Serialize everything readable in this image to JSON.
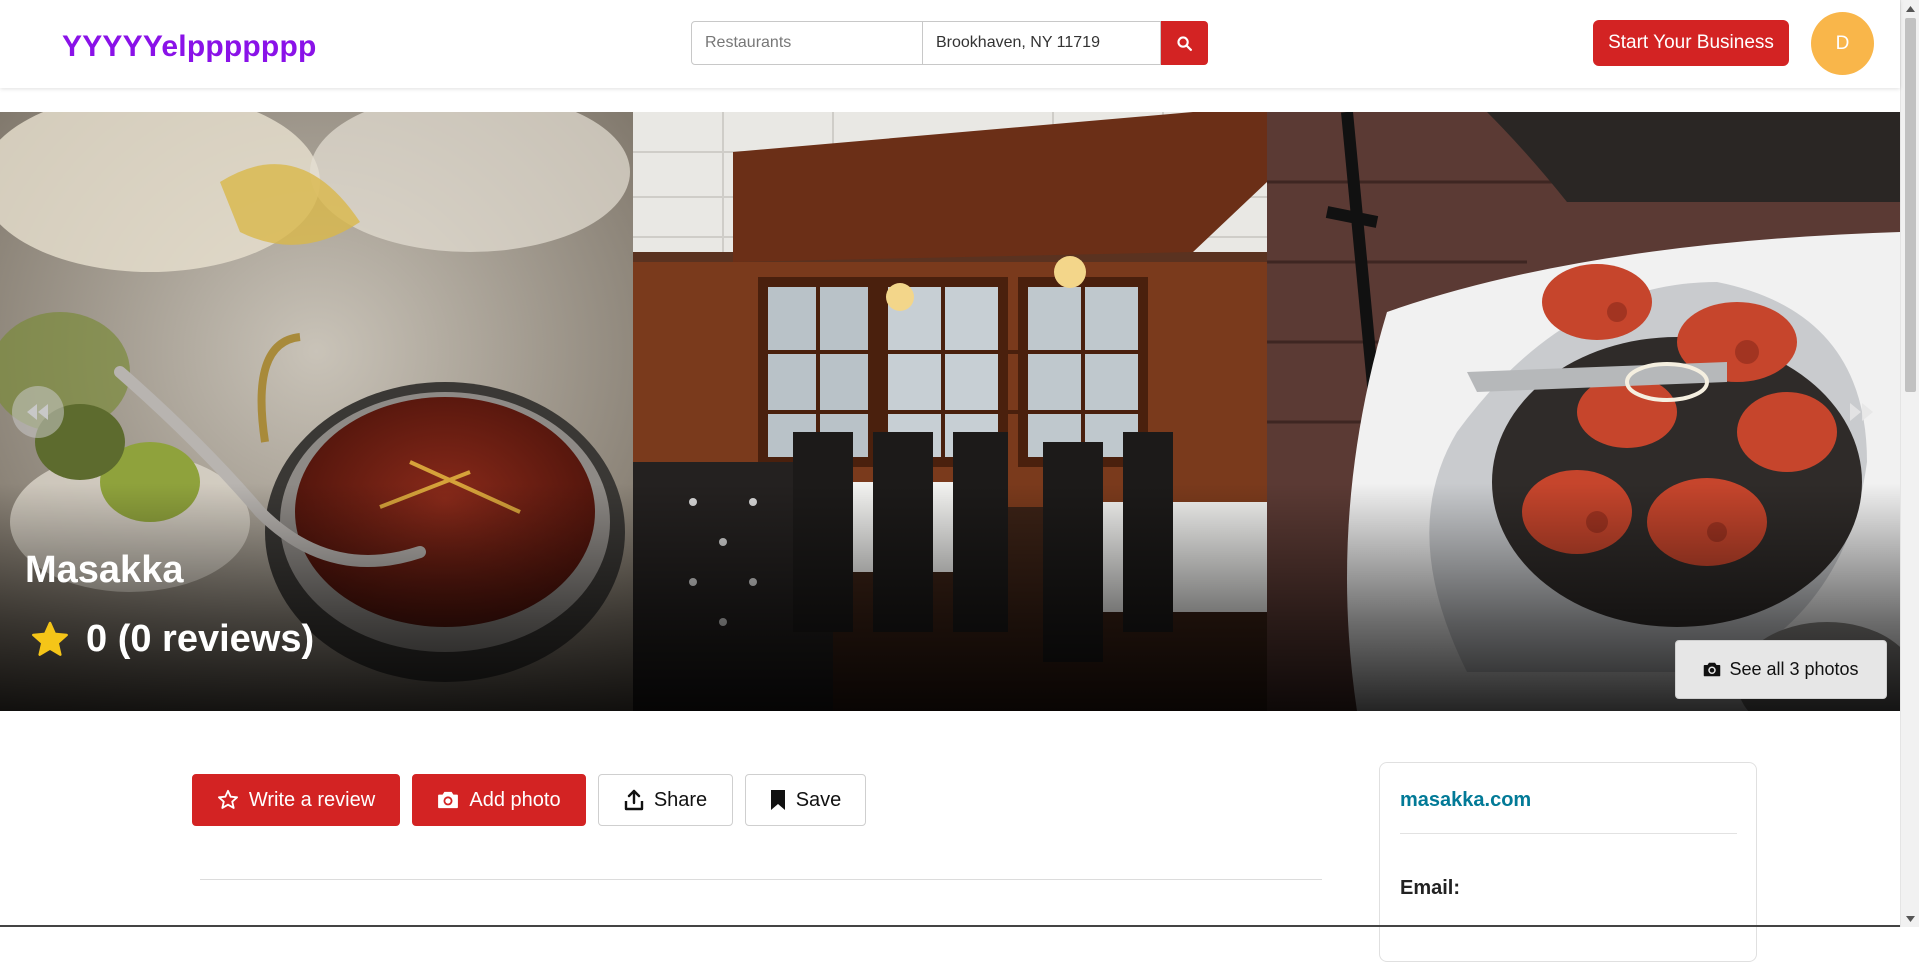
{
  "header": {
    "logo": "YYYYYelppppppp",
    "search_find_placeholder": "Restaurants",
    "search_near_value": "Brookhaven, NY 11719",
    "search_button_icon": "search-icon",
    "start_business_label": "Start Your Business",
    "avatar_initial": "D"
  },
  "hero": {
    "business_name": "Masakka",
    "rating_text": "0 (0 reviews)",
    "rating_icon": "star-icon",
    "see_all_label": "See all 3 photos",
    "photos": [
      "curry-dish-photo",
      "dining-room-photo",
      "tandoori-platter-photo"
    ]
  },
  "actions": {
    "write_review": "Write a review",
    "add_photo": "Add photo",
    "share": "Share",
    "save": "Save"
  },
  "sidebar": {
    "website": "masakka.com",
    "email_label": "Email:"
  },
  "colors": {
    "brand_red": "#d32323",
    "logo_purple": "#8a12e8",
    "avatar_orange": "#f9b64a",
    "link_teal": "#027a97",
    "star_yellow": "#f5c518"
  }
}
